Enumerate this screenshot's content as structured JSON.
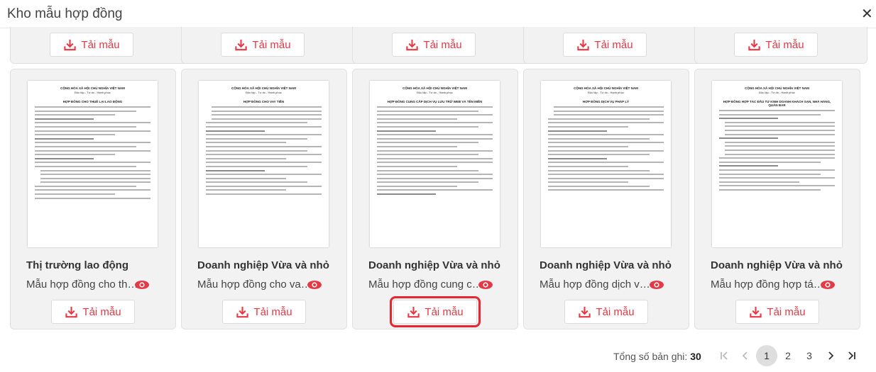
{
  "modal": {
    "title": "Kho mẫu hợp đồng",
    "close_icon": "✕"
  },
  "download_label": "Tải mẫu",
  "accent_color": "#e53945",
  "cards": [
    {
      "title": "Thị trường lao động",
      "desc": "Mẫu hợp đồng cho thuê lại lao động",
      "doc_header": "CỘNG HÒA XÃ HỘI CHỦ NGHĨA VIỆT NAM",
      "doc_sub": "Độc lập - Tự do - Hạnh phúc",
      "doc_title": "HỢP ĐỒNG CHO THUÊ LẠI LAO ĐỘNG"
    },
    {
      "title": "Doanh nghiệp Vừa và nhỏ",
      "desc": "Mẫu hợp đồng cho vay tiền",
      "doc_header": "CỘNG HÒA XÃ HỘI CHỦ NGHĨA VIỆT NAM",
      "doc_sub": "Độc lập - Tự do - Hạnh phúc",
      "doc_title": "HỢP ĐỒNG CHO VAY TIỀN"
    },
    {
      "title": "Doanh nghiệp Vừa và nhỏ",
      "desc": "Mẫu hợp đồng cung cấp dịch vụ",
      "doc_header": "CỘNG HÒA XÃ HỘI CHỦ NGHĨA VIỆT NAM",
      "doc_sub": "Độc lập - Tự do - Hạnh phúc",
      "doc_title": "HỢP ĐỒNG CUNG CẤP DỊCH VỤ LƯU TRỮ WEB VÀ TÊN MIỀN"
    },
    {
      "title": "Doanh nghiệp Vừa và nhỏ",
      "desc": "Mẫu hợp đồng dịch vụ pháp lý",
      "doc_header": "CỘNG HÒA XÃ HỘI CHỦ NGHĨA VIỆT NAM",
      "doc_sub": "Độc lập - Tự do - Hạnh phúc",
      "doc_title": "HỢP ĐỒNG DỊCH VỤ PHÁP LÝ"
    },
    {
      "title": "Doanh nghiệp Vừa và nhỏ",
      "desc": "Mẫu hợp đồng hợp tác kinh doanh",
      "doc_header": "CỘNG HÒA XÃ HỘI CHỦ NGHĨA VIỆT NAM",
      "doc_sub": "Độc lập - Tự do - Hạnh phúc",
      "doc_title": "HỢP ĐỒNG HỢP TÁC ĐẦU TƯ KINH DOANH KHÁCH SẠN, NHÀ HÀNG, QUÁN BAR"
    }
  ],
  "pagination": {
    "total_label": "Tổng số bản ghi:",
    "total": "30",
    "pages": [
      "1",
      "2",
      "3"
    ],
    "current": "1"
  }
}
